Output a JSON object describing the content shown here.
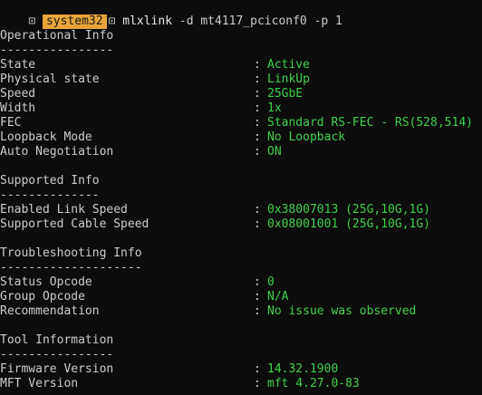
{
  "prompt": {
    "icon_glyph": "⊡",
    "folder": "system32",
    "command": "mlxlink",
    "args": "-d mt4117_pciconf0 -p 1"
  },
  "sections": [
    {
      "title": "Operational Info",
      "underline": "----------------",
      "rows": [
        {
          "key": "State",
          "value": "Active"
        },
        {
          "key": "Physical state",
          "value": "LinkUp"
        },
        {
          "key": "Speed",
          "value": "25GbE"
        },
        {
          "key": "Width",
          "value": "1x"
        },
        {
          "key": "FEC",
          "value": "Standard RS-FEC - RS(528,514)"
        },
        {
          "key": "Loopback Mode",
          "value": "No Loopback"
        },
        {
          "key": "Auto Negotiation",
          "value": "ON"
        }
      ]
    },
    {
      "title": "Supported Info",
      "underline": "--------------",
      "rows": [
        {
          "key": "Enabled Link Speed",
          "value": "0x38007013 (25G,10G,1G)"
        },
        {
          "key": "Supported Cable Speed",
          "value": "0x08001001 (25G,10G,1G)"
        }
      ]
    },
    {
      "title": "Troubleshooting Info",
      "underline": "--------------------",
      "rows": [
        {
          "key": "Status Opcode",
          "value": "0"
        },
        {
          "key": "Group Opcode",
          "value": "N/A"
        },
        {
          "key": "Recommendation",
          "value": "No issue was observed"
        }
      ]
    },
    {
      "title": "Tool Information",
      "underline": "----------------",
      "rows": [
        {
          "key": "Firmware Version",
          "value": "14.32.1900"
        },
        {
          "key": "MFT Version",
          "value": "mft 4.27.0-83"
        }
      ]
    }
  ],
  "colors": {
    "background": "#0c0c0c",
    "text": "#cccccc",
    "value": "#3fd14a",
    "prompt_segment": "#e8a33a"
  }
}
